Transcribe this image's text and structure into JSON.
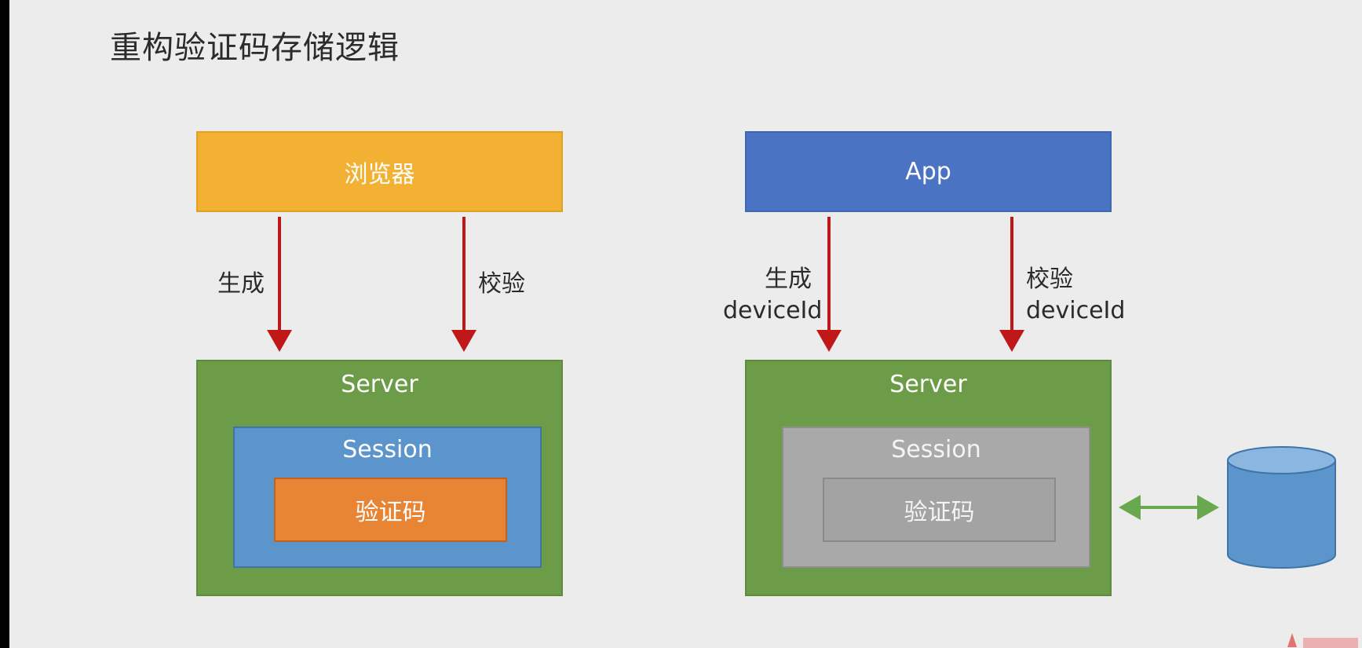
{
  "title": "重构验证码存储逻辑",
  "left": {
    "client": "浏览器",
    "generate_label": "生成",
    "verify_label": "校验",
    "server": "Server",
    "session": "Session",
    "code": "验证码"
  },
  "right": {
    "client": "App",
    "generate_label": "生成",
    "generate_sub": "deviceId",
    "verify_label": "校验",
    "verify_sub": "deviceId",
    "server": "Server",
    "session": "Session",
    "code": "验证码"
  },
  "colors": {
    "browser": "#f2b132",
    "app": "#4a73c3",
    "server": "#6c9c47",
    "session_active": "#5b95cc",
    "session_inactive": "#a9a9a9",
    "code_active": "#e88535",
    "arrow": "#c01818",
    "link": "#6aa84f",
    "database": "#5b95cc"
  }
}
